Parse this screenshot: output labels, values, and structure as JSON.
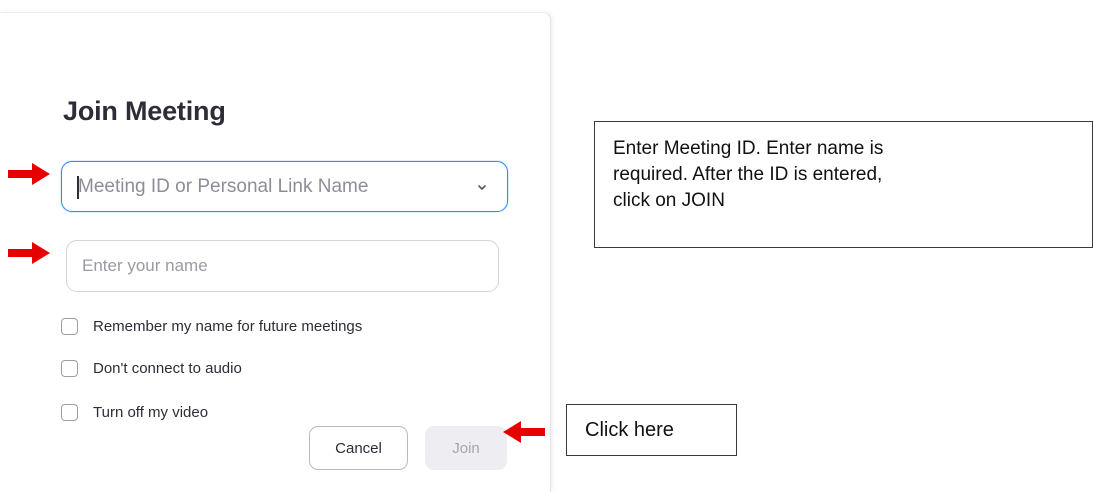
{
  "dialog": {
    "title": "Join Meeting",
    "meeting_id_field": {
      "value": "",
      "placeholder": "Meeting ID or Personal Link Name"
    },
    "name_field": {
      "value": "",
      "placeholder": "Enter your name"
    },
    "options": [
      {
        "label": "Remember my name for future meetings",
        "checked": false
      },
      {
        "label": "Don't connect to audio",
        "checked": false
      },
      {
        "label": "Turn off my video",
        "checked": false
      }
    ],
    "cancel_label": "Cancel",
    "join_label": "Join"
  },
  "annotations": {
    "instruction_lines": [
      "Enter Meeting ID.  Enter name is",
      "required. After the ID is entered,",
      "click on JOIN"
    ],
    "click_label": "Click here",
    "arrow_color": "#e60000"
  },
  "colors": {
    "focus_border": "#2d8cff",
    "join_disabled_bg": "#eeeef2"
  }
}
